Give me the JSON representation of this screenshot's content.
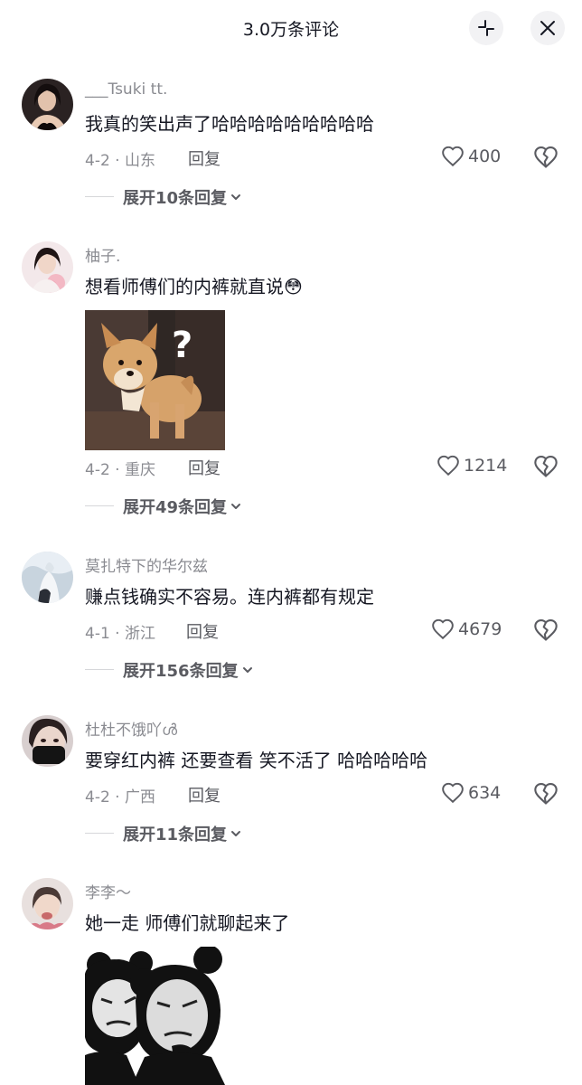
{
  "header": {
    "title": "3.0万条评论"
  },
  "comments": [
    {
      "username": "___Tsuki tt.",
      "text": "我真的笑出声了哈哈哈哈哈哈哈哈哈",
      "meta": "4-2 · 山东",
      "reply_label": "回复",
      "likes": "400",
      "expand_label": "展开10条回复"
    },
    {
      "username": "柚子.",
      "text": "想看师傅们的内裤就直说",
      "emoji": "😳",
      "meta": "4-2 · 重庆",
      "reply_label": "回复",
      "likes": "1214",
      "expand_label": "展开49条回复",
      "image_overlay": "?"
    },
    {
      "username": "莫扎特下的华尔兹",
      "text": "赚点钱确实不容易。连内裤都有规定",
      "meta": "4-1 · 浙江",
      "reply_label": "回复",
      "likes": "4679",
      "expand_label": "展开156条回复"
    },
    {
      "username": "杜杜不饿吖ൾ",
      "text": "要穿红内裤 还要查看 笑不活了 哈哈哈哈哈",
      "meta": "4-2 · 广西",
      "reply_label": "回复",
      "likes": "634",
      "expand_label": "展开11条回复"
    },
    {
      "username": "李李～",
      "text": "她一走 师傅们就聊起来了"
    }
  ],
  "icons": {
    "collapse": "collapse-icon",
    "close": "close-icon",
    "like": "heart-outline-icon",
    "dislike": "broken-heart-icon",
    "expand": "chevron-down-icon"
  },
  "colors": {
    "text_primary": "#161823",
    "text_secondary": "#8a8b91",
    "header_button_bg": "#f2f2f4"
  }
}
